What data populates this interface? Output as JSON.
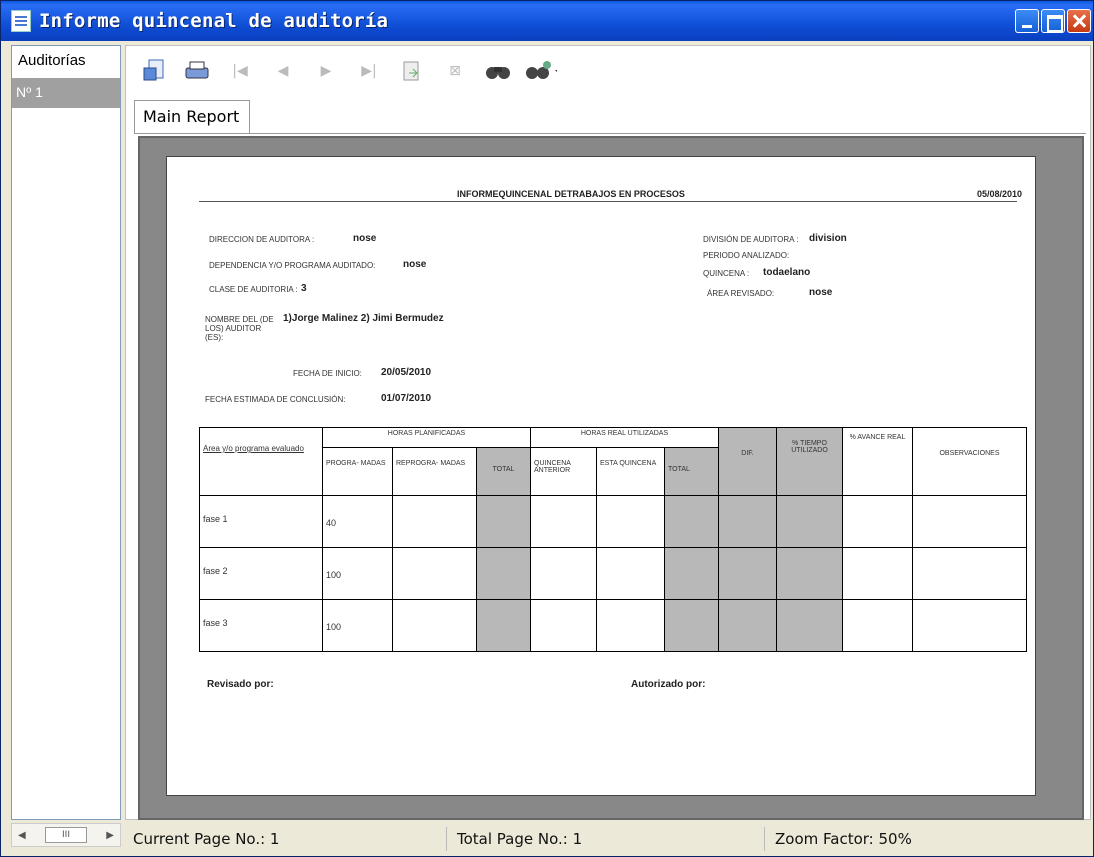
{
  "window": {
    "title": "Informe quincenal de auditoría"
  },
  "sidebar": {
    "header": "Auditorías",
    "items": [
      "Nº 1"
    ],
    "scroll_thumb": "III"
  },
  "toolbar": {
    "icons": [
      "export-icon",
      "print-icon",
      "first-page-icon",
      "prev-page-icon",
      "next-page-icon",
      "last-page-icon",
      "goto-page-icon",
      "stop-icon",
      "search-icon",
      "zoom-icon"
    ]
  },
  "tabs": [
    {
      "label": "Main Report"
    }
  ],
  "report": {
    "title": "INFORMEQUINCENAL DETRABAJOS EN PROCESOS",
    "date": "05/08/2010",
    "direccion_label": "DIRECCION DE AUDITORA :",
    "direccion_value": "nose",
    "dependencia_label": "DEPENDENCIA Y/O PROGRAMA AUDITADO:",
    "dependencia_value": "nose",
    "clase_label": "CLASE DE AUDITORIA :",
    "clase_value": "3",
    "nombre_label": "NOMBRE DEL (DE LOS) AUDITOR (ES):",
    "nombre_value": "1)Jorge Malinez 2) Jimi Bermudez",
    "division_label": "DIVISIÓN DE AUDITORA :",
    "division_value": "division",
    "periodo_label": "PERIODO ANALIZADO:",
    "quincena_label": "QUINCENA :",
    "quincena_value": "todaelano",
    "area_label": "ÁREA REVISADO:",
    "area_value": "nose",
    "fecha_inicio_label": "FECHA DE INICIO:",
    "fecha_inicio_value": "20/05/2010",
    "fecha_fin_label": "FECHA ESTIMADA DE CONCLUSIÓN:",
    "fecha_fin_value": "01/07/2010",
    "table": {
      "col_area": "Area y/o programa evaluado",
      "grp_plan": "HORAS PLANIFICADAS",
      "grp_real": "HORAS REAL UTILIZADAS",
      "col_dif": "DIF.",
      "col_tiempo": "% TIEMPO UTILIZADO",
      "col_avance": "% AVANCE REAL",
      "col_obs": "OBSERVACIONES",
      "sub": [
        "PROGRA- MADAS",
        "REPROGRA- MADAS",
        "TOTAL",
        "QUINCENA ANTERIOR",
        "ESTA QUINCENA",
        "TOTAL"
      ],
      "rows": [
        {
          "fase": "fase 1",
          "prog": "40"
        },
        {
          "fase": "fase 2",
          "prog": "100"
        },
        {
          "fase": "fase 3",
          "prog": "100"
        }
      ]
    },
    "revisado": "Revisado por:",
    "autorizado": "Autorizado por:"
  },
  "status": {
    "current": "Current Page No.: 1",
    "total": "Total Page No.: 1",
    "zoom": "Zoom Factor: 50%"
  }
}
